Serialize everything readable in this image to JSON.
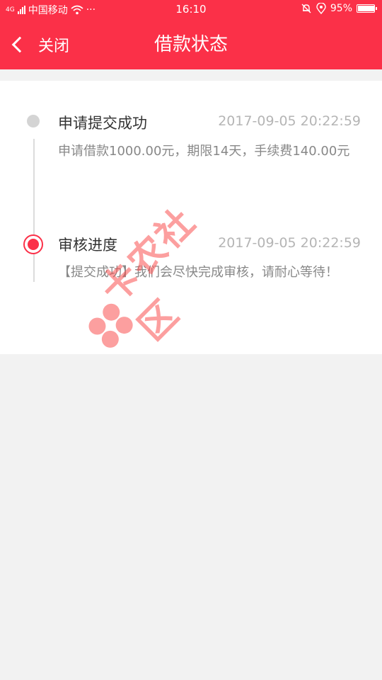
{
  "status_bar": {
    "network_tag": "4G",
    "carrier": "中国移动",
    "more": "···",
    "time": "16:10",
    "battery_text": "95%",
    "battery_level": 0.95
  },
  "nav": {
    "back_label": "关闭",
    "title": "借款状态"
  },
  "timeline": [
    {
      "title": "申请提交成功",
      "time": "2017-09-05 20:22:59",
      "desc": "申请借款1000.00元，期限14天，手续费140.00元"
    },
    {
      "title": "审核进度",
      "time": "2017-09-05 20:22:59",
      "desc": "【提交成功】我们会尽快完成审核，请耐心等待！"
    }
  ],
  "watermark": {
    "text": "卡农社区"
  },
  "colors": {
    "accent": "#fb3048",
    "inactive_dot": "#d4d4d4"
  }
}
